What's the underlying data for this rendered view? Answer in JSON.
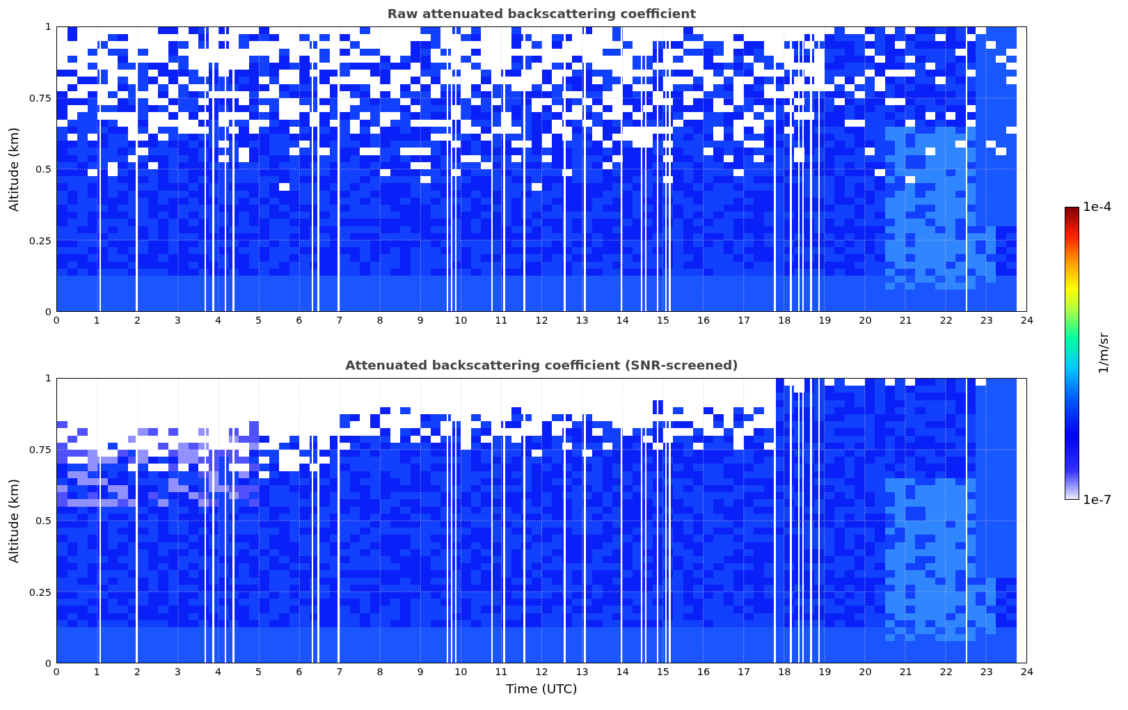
{
  "figure": {
    "panels": [
      {
        "kind": "raw",
        "title": "Raw attenuated backscattering coefficient",
        "ylabel": "Altitude (km)",
        "yticks": [
          "1",
          "0.75",
          "0.5",
          "0.25",
          "0"
        ],
        "xticks": [
          "0",
          "1",
          "2",
          "3",
          "4",
          "5",
          "6",
          "7",
          "8",
          "9",
          "10",
          "11",
          "12",
          "13",
          "14",
          "15",
          "16",
          "17",
          "18",
          "19",
          "20",
          "21",
          "22",
          "23",
          "24"
        ]
      },
      {
        "kind": "screened",
        "title": "Attenuated backscattering coefficient (SNR-screened)",
        "ylabel": "Altitude (km)",
        "yticks": [
          "1",
          "0.75",
          "0.5",
          "0.25",
          "0"
        ],
        "xticks": [
          "0",
          "1",
          "2",
          "3",
          "4",
          "5",
          "6",
          "7",
          "8",
          "9",
          "10",
          "11",
          "12",
          "13",
          "14",
          "15",
          "16",
          "17",
          "18",
          "19",
          "20",
          "21",
          "22",
          "23",
          "24"
        ],
        "xlabel": "Time (UTC)"
      }
    ],
    "colorbar": {
      "max_label": "1e-4",
      "min_label": "1e-7",
      "label": "1/m/sr"
    }
  }
}
